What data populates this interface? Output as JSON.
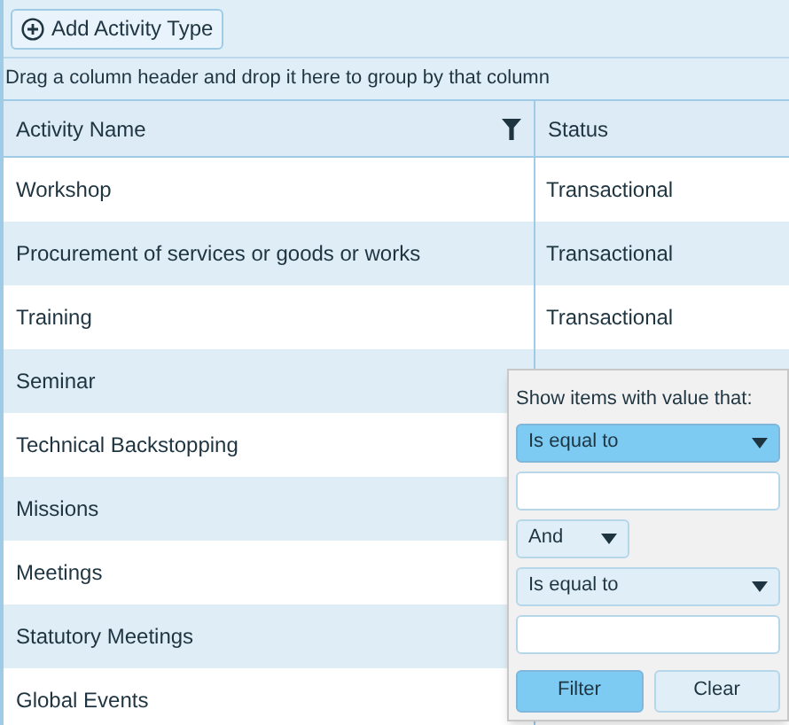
{
  "toolbar": {
    "add_button": "Add Activity Type"
  },
  "group_bar": "Drag a column header and drop it here to group by that column",
  "table": {
    "columns": [
      {
        "label": "Activity Name",
        "filtered": true
      },
      {
        "label": "Status",
        "filtered": false
      }
    ],
    "rows": [
      {
        "name": "Workshop",
        "status": "Transactional"
      },
      {
        "name": "Procurement of services or goods or works",
        "status": "Transactional"
      },
      {
        "name": "Training",
        "status": "Transactional"
      },
      {
        "name": "Seminar"
      },
      {
        "name": "Technical Backstopping"
      },
      {
        "name": "Missions"
      },
      {
        "name": "Meetings"
      },
      {
        "name": "Statutory Meetings"
      },
      {
        "name": "Global Events"
      }
    ]
  },
  "filter_menu": {
    "heading": "Show items with value that:",
    "operator_1": "Is equal to",
    "logic": "And",
    "operator_2": "Is equal to",
    "buttons": [
      {
        "label": "Filter",
        "primary": true
      },
      {
        "label": "Clear",
        "primary": false
      }
    ]
  }
}
